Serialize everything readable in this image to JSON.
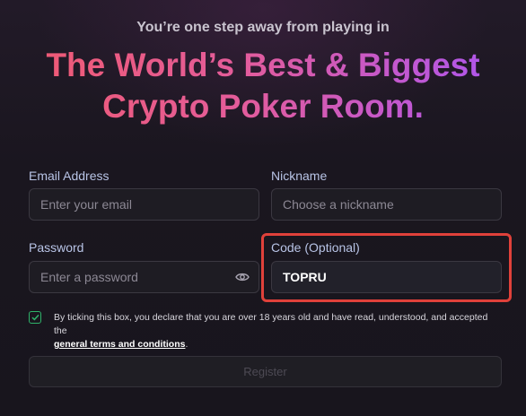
{
  "header": {
    "subtitle": "You’re one step away from playing in",
    "headline_line1": "The World’s Best & Biggest",
    "headline_line2": "Crypto Poker Room."
  },
  "form": {
    "email": {
      "label": "Email Address",
      "placeholder": "Enter your email",
      "value": ""
    },
    "nickname": {
      "label": "Nickname",
      "placeholder": "Choose a nickname",
      "value": ""
    },
    "password": {
      "label": "Password",
      "placeholder": "Enter a password",
      "value": "",
      "toggle_icon": "eye-icon"
    },
    "code": {
      "label": "Code (Optional)",
      "placeholder": "",
      "value": "TOPRU"
    },
    "consent": {
      "checked": true,
      "text": "By ticking this box, you declare that you are over 18 years old and have read, understood, and accepted the",
      "link_text": "general terms and conditions",
      "suffix": "."
    },
    "submit_label": "Register"
  },
  "colors": {
    "background": "#1a161f",
    "gradient_start": "#f05a6e",
    "gradient_end": "#a855f7",
    "checkbox": "#2fb36a",
    "highlight": "#e0413a"
  }
}
